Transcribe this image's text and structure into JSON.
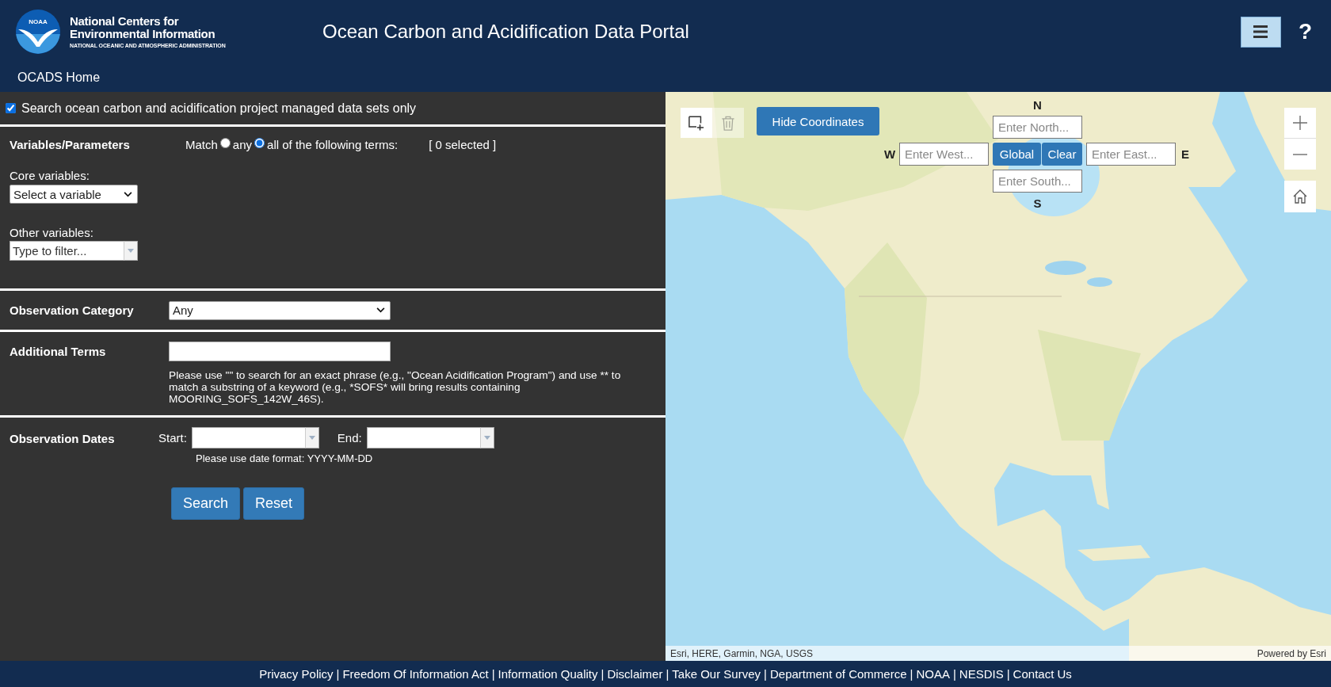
{
  "header": {
    "logo_text": "NOAA",
    "org_name_lines": [
      "National Centers for",
      "Environmental Information"
    ],
    "org_tagline": "NATIONAL OCEANIC AND ATMOSPHERIC ADMINISTRATION",
    "title": "Ocean Carbon and Acidification Data Portal",
    "help": "?",
    "nav_links": [
      "OCADS Home"
    ]
  },
  "search_panel": {
    "managed_only": {
      "label": "Search ocean carbon and acidification project managed data sets only",
      "checked": true
    },
    "variables": {
      "heading": "Variables/Parameters",
      "match_label": "Match",
      "match_options": [
        {
          "label": "any",
          "selected": false
        },
        {
          "label": "all of the following terms:",
          "selected": true
        }
      ],
      "selected_count": "[ 0 selected ]",
      "core_label": "Core variables:",
      "core_value": "Select a variable",
      "other_label": "Other variables:",
      "other_placeholder": "Type to filter..."
    },
    "observation_category": {
      "heading": "Observation Category",
      "value": "Any"
    },
    "additional_terms": {
      "heading": "Additional Terms",
      "help": "Please use \"\" to search for an exact phrase (e.g., \"Ocean Acidification Program\") and use ** to match a substring of a keyword (e.g., *SOFS* will bring results containing MOORING_SOFS_142W_46S)."
    },
    "observation_dates": {
      "heading": "Observation Dates",
      "start_label": "Start:",
      "end_label": "End:",
      "help": "Please use date format: YYYY-MM-DD"
    },
    "buttons": [
      "Search",
      "Reset"
    ]
  },
  "map": {
    "draw_tools": [
      {
        "kind": "rectangle",
        "disabled": false
      },
      {
        "kind": "delete",
        "disabled": true
      }
    ],
    "toggle_button": "Hide Coordinates",
    "bounds": {
      "north": {
        "label": "N",
        "placeholder": "Enter North..."
      },
      "west": {
        "label": "W",
        "placeholder": "Enter West..."
      },
      "east": {
        "label": "E",
        "placeholder": "Enter East..."
      },
      "south": {
        "label": "S",
        "placeholder": "Enter South..."
      },
      "buttons": [
        "Global",
        "Clear"
      ]
    },
    "attribution": "Esri, HERE, Garmin, NGA, USGS",
    "powered_by": "Powered by Esri"
  },
  "footer": {
    "separator": "|",
    "links": [
      "Privacy Policy",
      "Freedom Of Information Act",
      "Information Quality",
      "Disclaimer",
      "Take Our Survey",
      "Department of Commerce",
      "NOAA",
      "NESDIS",
      "Contact Us"
    ]
  }
}
